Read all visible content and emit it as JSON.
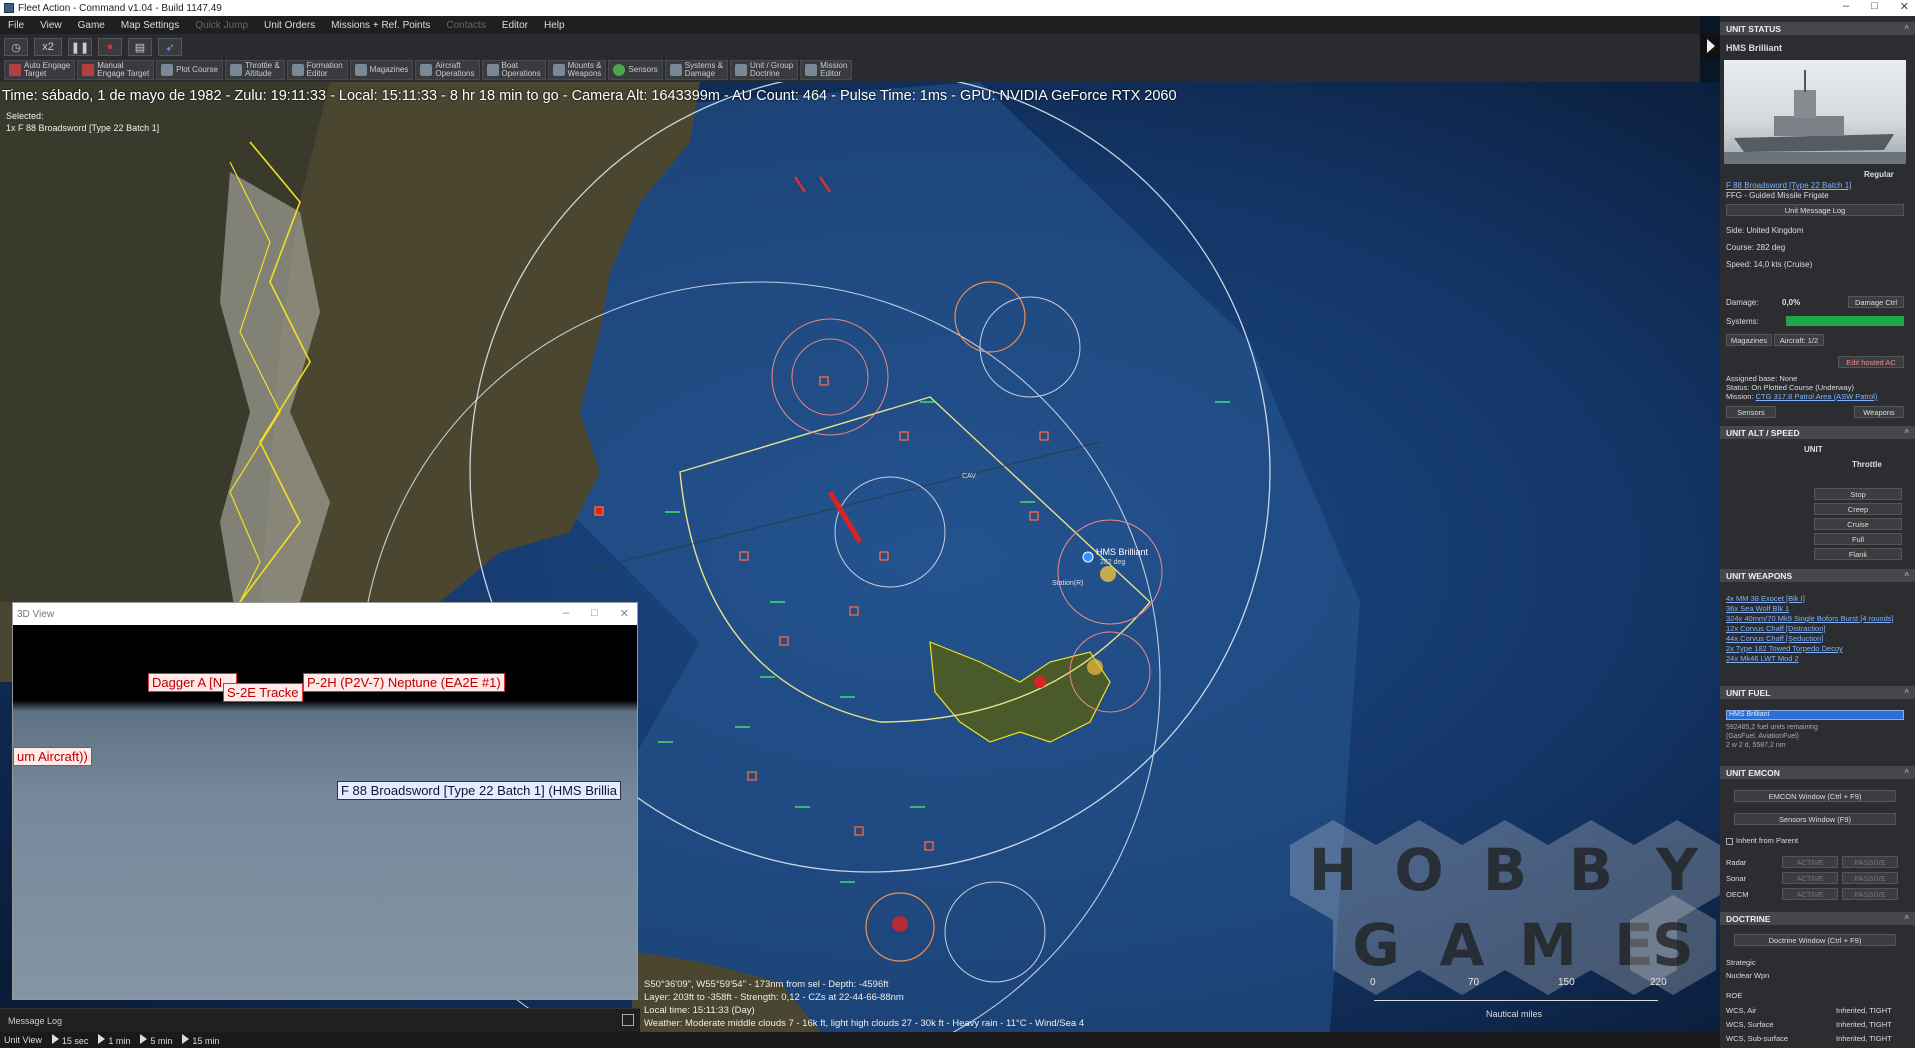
{
  "window": {
    "title": "Fleet Action - Command v1.04 - Build 1147.49"
  },
  "menu": [
    "File",
    "View",
    "Game",
    "Map Settings",
    "Quick Jump",
    "Unit Orders",
    "Missions + Ref. Points",
    "Contacts",
    "Editor",
    "Help"
  ],
  "toolbar": {
    "time_compression": "x2",
    "commands": [
      "Auto Engage\nTarget",
      "Manual\nEngage Target",
      "Plot Course",
      "Throttle &\nAltitude",
      "Formation\nEditor",
      "Magazines",
      "Aircraft\nOperations",
      "Boat\nOperations",
      "Mounts &\nWeapons",
      "Sensors",
      "Systems &\nDamage",
      "Unit / Group\nDoctrine",
      "Mission\nEditor"
    ]
  },
  "status_line": "Time: sábado, 1 de mayo de 1982 - Zulu: 19:11:33 - Local: 15:11:33 - 8 hr 18 min to go -  Camera Alt: 1643399m  - AU Count: 464 - Pulse Time: 1ms - GPU: NVIDIA GeForce RTX 2060",
  "selected": {
    "label": "Selected:",
    "unit": "1x F 88 Broadsword [Type 22 Batch 1]"
  },
  "map": {
    "hms_label": "HMS Brilliant",
    "hms_course": "282 deg",
    "station_label": "Station(R)",
    "cav_label": "CAV",
    "cursor_readout": [
      "S50°36'09\", W55°59'54\" - 173nm from sel - Depth: -4596ft",
      "Layer: 203ft to -358ft - Strength: 0,12 - CZs at 22-44-66-88nm",
      "Local time: 15:11:33 (Day)",
      "Weather: Moderate middle clouds 7 - 16k ft, light high clouds 27 - 30k ft - Heavy rain - 11°C - Wind/Sea 4"
    ],
    "scale": {
      "ticks": [
        "0",
        "70",
        "150",
        "220"
      ],
      "unit": "Nautical miles"
    }
  },
  "watermark": {
    "top": [
      "H",
      "O",
      "B",
      "B",
      "Y"
    ],
    "bottom": [
      "G",
      "A",
      "M",
      "E",
      "S"
    ]
  },
  "view3d": {
    "title": "3D View",
    "tags": {
      "dagger": "Dagger A [N...",
      "s2e": "S-2E Tracke",
      "neptune": "P-2H (P2V-7) Neptune (EA2E #1)",
      "aircraft": "um Aircraft))",
      "broadsword": "F 88 Broadsword [Type 22 Batch 1] (HMS Brillia"
    }
  },
  "message_log": "Message Log",
  "bottom": {
    "label": "Unit View",
    "steps": [
      "15 sec",
      "1 min",
      "5 min",
      "15 min"
    ]
  },
  "panel": {
    "unit_status": "UNIT STATUS",
    "unit_name": "HMS Brilliant",
    "proficiency": "Regular",
    "class_link": "F 88 Broadsword [Type 22 Batch 1]",
    "type": "FFG - Guided Missile Frigate",
    "msg_log_btn": "Unit Message Log",
    "side": "Side: United Kingdom",
    "course": "Course: 282 deg",
    "speed": "Speed: 14,0 kts (Cruise)",
    "damage_label": "Damage:",
    "damage_value": "0,0%",
    "damage_btn": "Damage Ctrl",
    "systems_label": "Systems:",
    "systems_level": 1.0,
    "magazines_btn": "Magazines",
    "aircraft_btn": "Aircraft: 1/2",
    "edit_hosted_btn": "Edit hosted AC",
    "assigned_base": "Assigned base: None",
    "status": "Status: On Plotted Course (Underway)",
    "mission_label": "Mission:",
    "mission_link": "CTG 317.8 Patrol Area (ASW Patrol)",
    "sensors_btn": "Sensors",
    "weapons_btn": "Weapons",
    "alt_speed": "UNIT ALT / SPEED",
    "unit_label": "UNIT",
    "throttle_label": "Throttle",
    "throttle": [
      "Stop",
      "Creep",
      "Cruise",
      "Full",
      "Flank"
    ],
    "unit_weapons": "UNIT WEAPONS",
    "weapons": [
      "4x MM 38 Exocet [Blk I]",
      "36x Sea Wolf Blk 1",
      "324x 40mm/70 Mk9 Single Bofors Burst [4 rounds]",
      "12x Corvus Chaff [Distraction]",
      "44x Corvus Chaff [Seduction]",
      "2x Type 182 Towed Torpedo Decoy",
      "24x Mk46 LWT Mod 2"
    ],
    "unit_fuel": "UNIT FUEL",
    "fuel_bar_label": "HMS Brilliant",
    "fuel_level": 1.0,
    "fuel_text": [
      "592485,2 fuel units remaining",
      "(GasFuel, AviationFuel)",
      "2 w 2 d, 5587,2 nm"
    ],
    "unit_emcon": "UNIT EMCON",
    "emcon_btn": "EMCON Window (Ctrl + F9)",
    "sensors_window_btn": "Sensors Window (F9)",
    "inherit_label": "Inherit from Parent",
    "emcon_rows": [
      "Radar",
      "Sonar",
      "OECM"
    ],
    "active": "ACTIVE",
    "passive": "PASSIVE",
    "doctrine": "DOCTRINE",
    "doctrine_btn": "Doctrine Window (Ctrl + F9)",
    "strategic": "Strategic",
    "nuclear": "Nuclear Wpn",
    "roe": "ROE",
    "wcs_rows": [
      {
        "label": "WCS, Air",
        "value": "Inherited, TIGHT"
      },
      {
        "label": "WCS, Surface",
        "value": "Inherited, TIGHT"
      },
      {
        "label": "WCS, Sub-surface",
        "value": "Inherited, TIGHT"
      }
    ]
  },
  "colors": {
    "land": "#4a4630",
    "ocean": "#0d2240",
    "friendly": "#cfe6ff",
    "hostile": "#e03030",
    "coast": "#f0e020"
  }
}
